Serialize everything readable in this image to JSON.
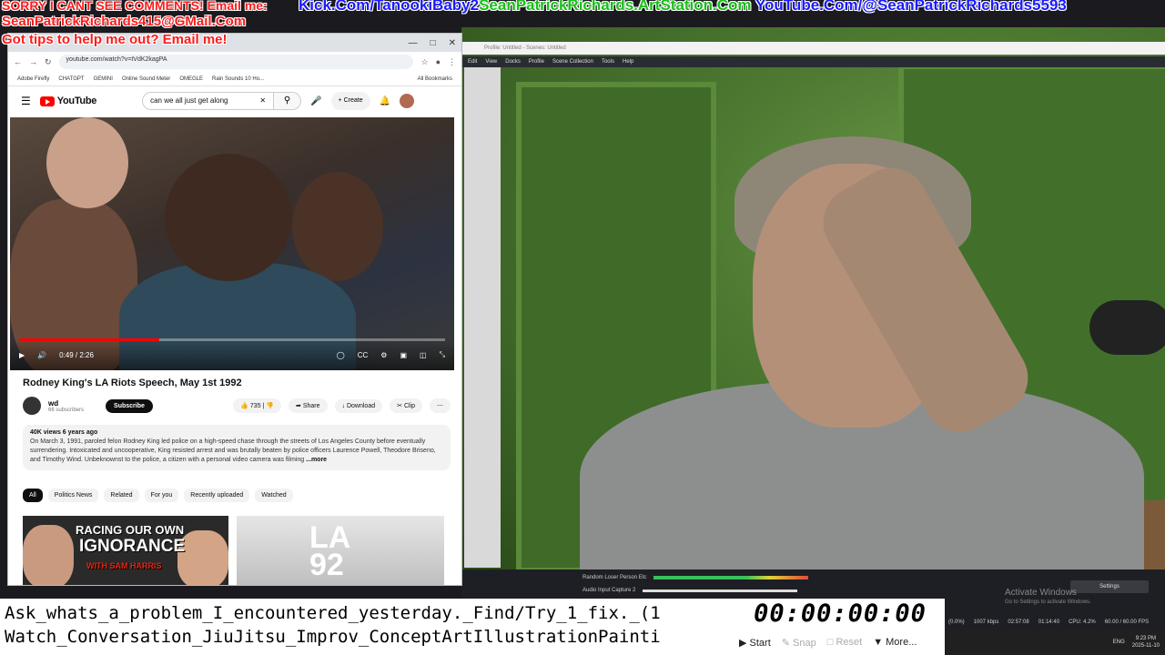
{
  "overlay": {
    "line1": "SORRY I CANT SEE COMMENTS! Email me:",
    "kick": "Kick.Com/TanookiBaby2",
    "artstation": "SeanPatrickRichards.ArtStation.Com",
    "youtube": "YouTube.Com/@SeanPatrickRichards5593",
    "email": "SeanPatrickRichards415@GMail.Com",
    "tips": "Got tips to help me out? Email me!"
  },
  "browser": {
    "url": "youtube.com/watch?v=tVdK2kagPA",
    "bookmarks": [
      "Adobe Firefly",
      "CHATGPT",
      "GEMINI",
      "Online Sound Meter",
      "OMEGLE",
      "Rain Sounds 10 Ho...",
      "All Bookmarks"
    ],
    "search_value": "can we all just get along",
    "create_label": "Create",
    "brand": "YouTube",
    "video": {
      "time": "0:49 / 2:26",
      "progress": 0.33,
      "title": "Rodney King's LA Riots Speech, May 1st 1992"
    },
    "channel": {
      "name": "wd",
      "subs": "66 subscribers",
      "subscribe": "Subscribe"
    },
    "actions": {
      "likes": "735",
      "share": "Share",
      "download": "Download",
      "clip": "Clip"
    },
    "description": {
      "meta": "40K views  6 years ago",
      "text": "On March 3, 1991, paroled felon Rodney King led police on a high-speed chase through the streets of Los Angeles County before eventually surrendering. Intoxicated and uncooperative, King resisted arrest and was brutally beaten by police officers Laurence Powell, Theodore Briseno, and Timothy Wind. Unbeknownst to the police, a citizen with a personal video camera was filming",
      "more": "...more"
    },
    "chips": [
      "All",
      "Politics News",
      "Related",
      "For you",
      "Recently uploaded",
      "Watched"
    ],
    "thumb1": {
      "l1": "RACING OUR OWN",
      "l2": "IGNORANCE",
      "l3": "WITH SAM HARRIS"
    },
    "thumb2": {
      "l1": "LA",
      "l2": "92"
    }
  },
  "obs": {
    "title": "Profile: Untitled - Scenes: Untitled",
    "menu": [
      "Edit",
      "View",
      "Docks",
      "Profile",
      "Scene Collection",
      "Tools",
      "Help"
    ],
    "audio1": "Random Loser Person Etc",
    "audio2": "Audio Input Capture 2",
    "settings": "Settings",
    "activate1": "Activate Windows",
    "activate2": "Go to Settings to activate Windows.",
    "status": [
      "(0.0%)",
      "1007 kbps",
      "02:57:08",
      "01:14:40",
      "CPU: 4.2%",
      "60.00 / 60.00 FPS"
    ],
    "taskbar_time": "9:23 PM",
    "taskbar_date": "2025-11-10",
    "lang": "ENG"
  },
  "ticker": {
    "line1": "Ask_whats_a_problem_I_encountered_yesterday._Find/Try_1_fix._(1",
    "line2": "Watch_Conversation_JiuJitsu_Improv_ConceptArtIllustrationPainti"
  },
  "timer": "00:00:00:00",
  "controls": {
    "start": "Start",
    "snap": "Snap",
    "reset": "Reset",
    "more": "More..."
  },
  "colors": {
    "overlay_red": "#ff1a1a",
    "overlay_blue": "#1a1aff",
    "overlay_green": "#18c018",
    "yt_red": "#ff0000"
  }
}
